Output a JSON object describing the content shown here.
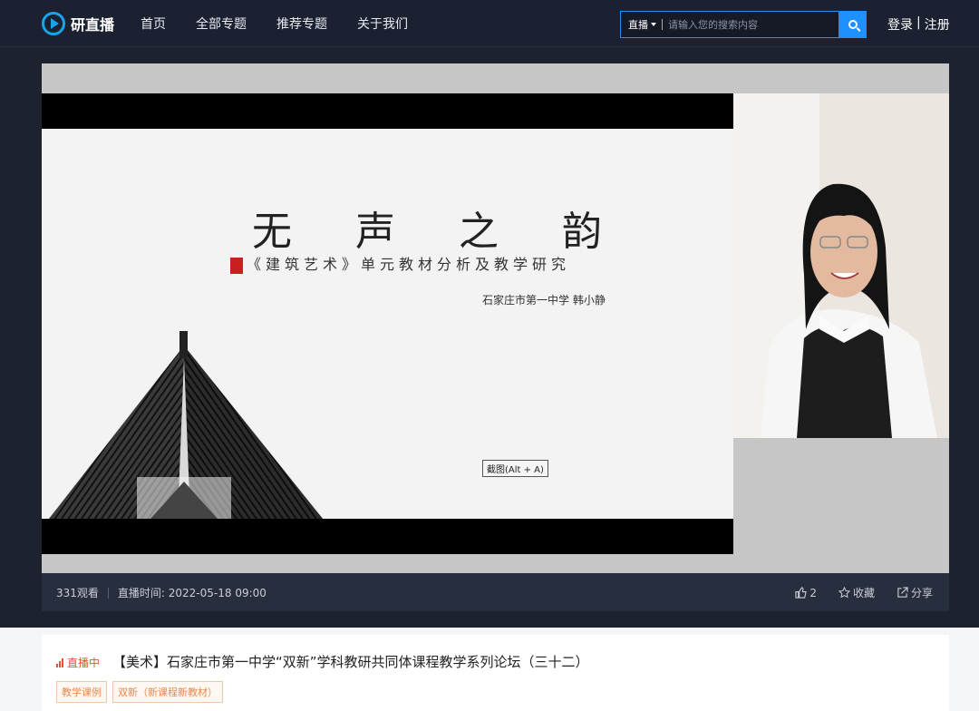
{
  "header": {
    "logo_text": "研直播",
    "nav": [
      "首页",
      "全部专题",
      "推荐专题",
      "关于我们"
    ],
    "search": {
      "type_label": "直播",
      "placeholder": "请输入您的搜索内容"
    },
    "login_label": "登录",
    "auth_sep": "|",
    "register_label": "注册"
  },
  "player": {
    "slide": {
      "title": "无声之韵",
      "subtitle": "《建筑艺术》单元教材分析及教学研究",
      "author": "石家庄市第一中学 韩小静"
    },
    "screenshot_hint": "截图(Alt + A)"
  },
  "info_bar": {
    "viewers": "331观看",
    "live_time": "直播时间: 2022-05-18 09:00",
    "likes": "2",
    "favorite_label": "收藏",
    "share_label": "分享"
  },
  "course": {
    "status": "直播中",
    "title": "【美术】石家庄市第一中学“双新”学科教研共同体课程教学系列论坛（三十二）",
    "tags": [
      "教学课例",
      "双新（新课程新教材）"
    ]
  },
  "colors": {
    "accent": "#1e90ff",
    "live": "#e8522c",
    "header_bg": "#1b2130"
  }
}
